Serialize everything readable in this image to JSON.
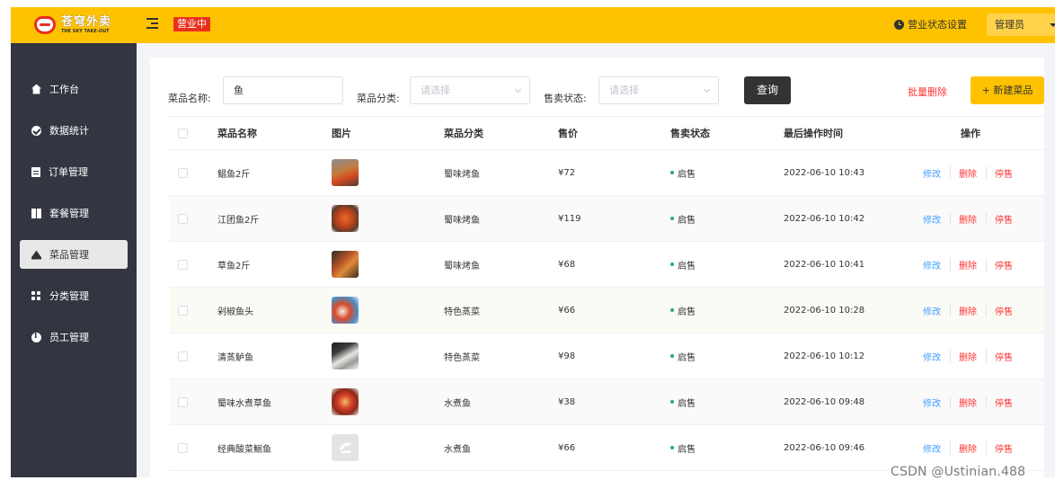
{
  "brand": {
    "name": "苍穹外卖",
    "sub": "THE SKY TAKE-OUT",
    "color": "#ffc200"
  },
  "header": {
    "status": "营业中",
    "settings_label": "营业状态设置",
    "user": "管理员"
  },
  "sidebar": {
    "items": [
      {
        "label": "工作台",
        "icon": "home-icon"
      },
      {
        "label": "数据统计",
        "icon": "chart-icon"
      },
      {
        "label": "订单管理",
        "icon": "order-icon"
      },
      {
        "label": "套餐管理",
        "icon": "gift-icon"
      },
      {
        "label": "菜品管理",
        "icon": "dish-icon",
        "active": true
      },
      {
        "label": "分类管理",
        "icon": "category-icon"
      },
      {
        "label": "员工管理",
        "icon": "info-icon"
      }
    ]
  },
  "filters": {
    "name_label": "菜品名称:",
    "name_value": "鱼",
    "category_label": "菜品分类:",
    "category_placeholder": "请选择",
    "status_label": "售卖状态:",
    "status_placeholder": "请选择",
    "query_button": "查询",
    "batch_delete": "批量删除",
    "new_button": "+ 新建菜品"
  },
  "table": {
    "columns": [
      "菜品名称",
      "图片",
      "菜品分类",
      "售价",
      "售卖状态",
      "最后操作时间",
      "操作"
    ],
    "rows": [
      {
        "name": "鲳鱼2斤",
        "category": "蜀味烤鱼",
        "price": "¥72",
        "status": "启售",
        "time": "2022-06-10 10:43",
        "actions": [
          "修改",
          "删除",
          "停售"
        ]
      },
      {
        "name": "江团鱼2斤",
        "category": "蜀味烤鱼",
        "price": "¥119",
        "status": "启售",
        "time": "2022-06-10 10:42",
        "actions": [
          "修改",
          "删除",
          "停售"
        ]
      },
      {
        "name": "草鱼2斤",
        "category": "蜀味烤鱼",
        "price": "¥68",
        "status": "启售",
        "time": "2022-06-10 10:41",
        "actions": [
          "修改",
          "删除",
          "停售"
        ]
      },
      {
        "name": "剁椒鱼头",
        "category": "特色蒸菜",
        "price": "¥66",
        "status": "启售",
        "time": "2022-06-10 10:28",
        "actions": [
          "修改",
          "删除",
          "停售"
        ]
      },
      {
        "name": "清蒸鲈鱼",
        "category": "特色蒸菜",
        "price": "¥98",
        "status": "启售",
        "time": "2022-06-10 10:12",
        "actions": [
          "修改",
          "删除",
          "停售"
        ]
      },
      {
        "name": "蜀味水煮草鱼",
        "category": "水煮鱼",
        "price": "¥38",
        "status": "启售",
        "time": "2022-06-10 09:48",
        "actions": [
          "修改",
          "删除",
          "停售"
        ]
      },
      {
        "name": "经典酸菜鮰鱼",
        "category": "水煮鱼",
        "price": "¥66",
        "status": "启售",
        "time": "2022-06-10 09:46",
        "actions": [
          "修改",
          "删除",
          "停售"
        ]
      }
    ]
  },
  "watermark": "CSDN @Ustinian.488"
}
